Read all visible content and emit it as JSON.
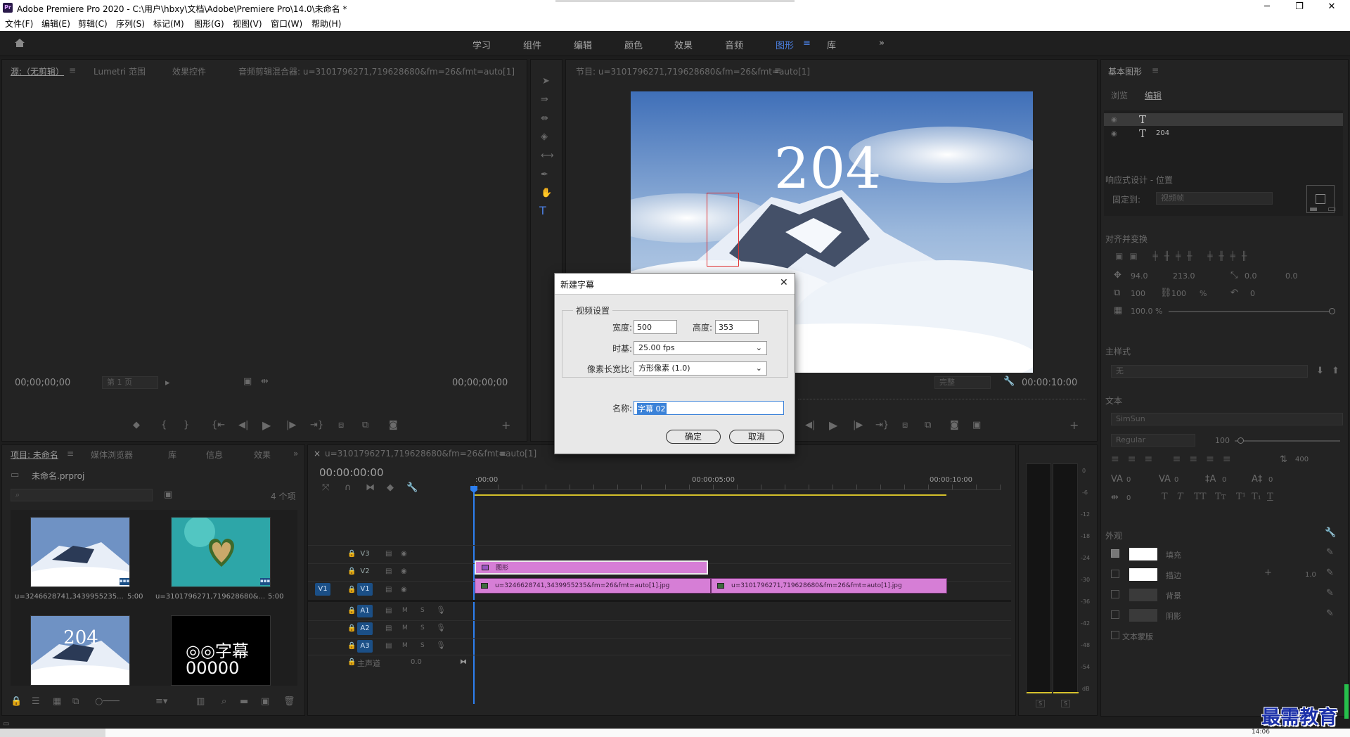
{
  "window": {
    "title": "Adobe Premiere Pro 2020 - C:\\用户\\hbxy\\文档\\Adobe\\Premiere Pro\\14.0\\未命名 *",
    "logo_text": "Pr",
    "min": "─",
    "restore": "❐",
    "close": "✕"
  },
  "menu": [
    "文件(F)",
    "编辑(E)",
    "剪辑(C)",
    "序列(S)",
    "标记(M)",
    "图形(G)",
    "视图(V)",
    "窗口(W)",
    "帮助(H)"
  ],
  "workspaces": [
    "学习",
    "组件",
    "编辑",
    "颜色",
    "效果",
    "音频",
    "图形",
    "库"
  ],
  "workspace_active": "图形",
  "workspace_more": "»",
  "source_panel": {
    "tabs": [
      "源:（无剪辑）",
      "Lumetri 范围",
      "效果控件",
      "音频剪辑混合器: u=3101796271,719628680&fm=26&fmt=auto[1]"
    ],
    "timecode_left": "00;00;00;00",
    "page": "第 1 页",
    "timecode_right": "00;00;00;00"
  },
  "program_panel": {
    "tab": "节目: u=3101796271,719628680&fm=26&fmt=auto[1]",
    "overlay_text": "204",
    "fit": "完整",
    "timecode_right": "00:00:10:00"
  },
  "project_panel": {
    "tabs": [
      "项目: 未命名",
      "媒体浏览器",
      "库",
      "信息",
      "效果"
    ],
    "file": "未命名.prproj",
    "count": "4 个项",
    "items": [
      {
        "name": "u=3246628741,3439955235...",
        "dur": "5:00"
      },
      {
        "name": "u=3101796271,719628680&...",
        "dur": "5:00"
      },
      {
        "name": "",
        "dur": "",
        "overlay": "204"
      },
      {
        "name": "",
        "dur": "",
        "overlay_top": "◎◎字幕",
        "overlay_bottom": "00000"
      }
    ]
  },
  "timeline": {
    "tab": "u=3101796271,719628680&fm=26&fmt=auto[1]",
    "timecode": "00:00:00:00",
    "ruler": [
      ":00:00",
      "00:00:05:00",
      "00:00:10:00"
    ],
    "tracks_v": [
      "V3",
      "V2",
      "V1"
    ],
    "tracks_a": [
      "A1",
      "A2",
      "A3"
    ],
    "master": "主声道",
    "master_val": "0.0",
    "source_patch": "V1",
    "clips": {
      "graphic": "图形",
      "clip1": "u=3246628741,3439955235&fm=26&fmt=auto[1].jpg",
      "clip2": "u=3101796271,719628680&fm=26&fmt=auto[1].jpg"
    }
  },
  "meter": {
    "ticks": [
      "0",
      "-6",
      "-12",
      "-18",
      "-24",
      "-30",
      "-36",
      "-42",
      "-48",
      "-54",
      "dB"
    ],
    "s_left": "S",
    "s_right": "S"
  },
  "essential_graphics": {
    "title": "基本图形",
    "tabs": [
      "浏览",
      "编辑"
    ],
    "layers": [
      {
        "label": ""
      },
      {
        "label": "204"
      }
    ],
    "responsive": "响应式设计 - 位置",
    "pin_to_label": "固定到:",
    "pin_to_value": "视频帧",
    "align_transform": "对齐并变换",
    "pos_x": "94.0",
    "pos_y": "213.0",
    "anchor_x": "0.0",
    "anchor_y": "0.0",
    "scale_w": "100",
    "scale_h": "100",
    "scale_unit": "%",
    "rotation": "0",
    "opacity": "100.0 %",
    "master_style": "主样式",
    "master_style_value": "无",
    "text_section": "文本",
    "font": "SimSun",
    "font_style": "Regular",
    "font_size": "100",
    "line_val": "400",
    "kern1": "0",
    "kern2": "0",
    "kern3": "0",
    "kern4": "0",
    "kern5": "0",
    "appearance": "外观",
    "fill": "填充",
    "stroke": "描边",
    "stroke_width": "1.0",
    "background": "背景",
    "shadow": "阴影",
    "text_mask": "文本蒙版",
    "font_buttons": [
      "T",
      "T",
      "TT",
      "Tᴛ",
      "T¹",
      "T₁",
      "T"
    ]
  },
  "dialog": {
    "title": "新建字幕",
    "group": "视频设置",
    "width_label": "宽度:",
    "width": "500",
    "height_label": "高度:",
    "height": "353",
    "timebase_label": "时基:",
    "timebase": "25.00 fps",
    "par_label": "像素长宽比:",
    "par": "方形像素 (1.0)",
    "name_label": "名称:",
    "name": "字幕 02",
    "ok": "确定",
    "cancel": "取消",
    "close": "✕"
  },
  "watermark": "最需教育",
  "status_partial": "14:06"
}
